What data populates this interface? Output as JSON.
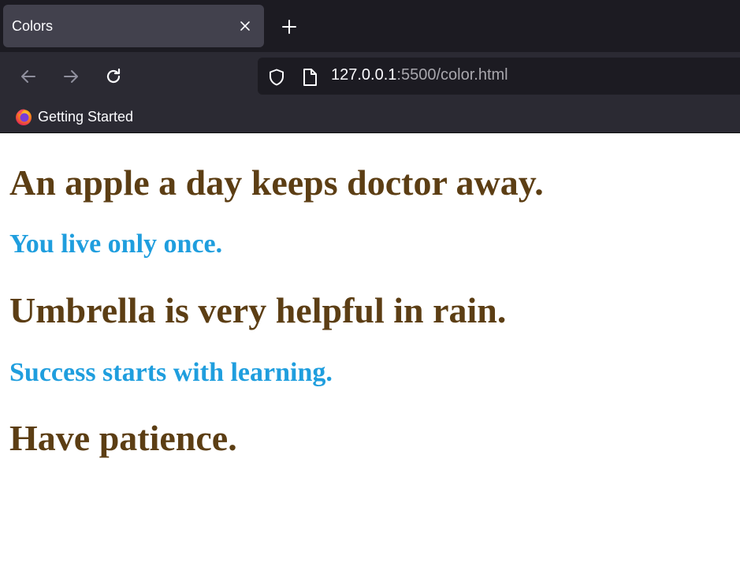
{
  "browser": {
    "tab": {
      "title": "Colors"
    },
    "address": {
      "host": "127.0.0.1",
      "rest": ":5500/color.html"
    },
    "bookmarks": [
      {
        "label": "Getting Started"
      }
    ]
  },
  "content": {
    "lines": [
      {
        "text": "An apple a day keeps doctor away.",
        "color": "#5c3e14"
      },
      {
        "text": "You live only once.",
        "color": "#1f9ede"
      },
      {
        "text": "Umbrella is very helpful in rain.",
        "color": "#5c3e14"
      },
      {
        "text": "Success starts with learning.",
        "color": "#1f9ede"
      },
      {
        "text": "Have patience.",
        "color": "#5c3e14"
      }
    ]
  }
}
